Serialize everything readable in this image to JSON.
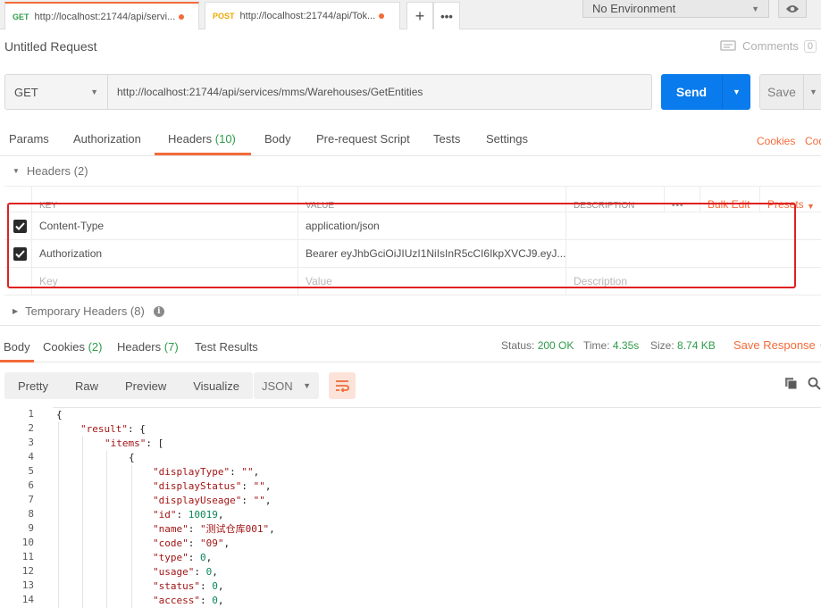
{
  "tabs": [
    {
      "method": "GET",
      "url": "http://localhost:21744/api/servi..."
    },
    {
      "method": "POST",
      "url": "http://localhost:21744/api/Tok..."
    }
  ],
  "environment": "No Environment",
  "request": {
    "title": "Untitled Request",
    "comments_label": "Comments",
    "comments_count": "0",
    "method": "GET",
    "url": "http://localhost:21744/api/services/mms/Warehouses/GetEntities",
    "send_label": "Send",
    "save_label": "Save"
  },
  "request_tabs": {
    "params": "Params",
    "authorization": "Authorization",
    "headers": "Headers",
    "headers_count": "(10)",
    "body": "Body",
    "prerequest": "Pre-request Script",
    "tests": "Tests",
    "settings": "Settings",
    "cookies": "Cookies",
    "code": "Code"
  },
  "headers_section": {
    "title": "Headers (2)",
    "columns": {
      "key": "KEY",
      "value": "VALUE",
      "description": "DESCRIPTION",
      "more": "•••",
      "bulk_edit": "Bulk Edit",
      "presets": "Presets"
    },
    "rows": [
      {
        "key": "Content-Type",
        "value": "application/json"
      },
      {
        "key": "Authorization",
        "value": "Bearer eyJhbGciOiJIUzI1NiIsInR5cCI6IkpXVCJ9.eyJ..."
      }
    ],
    "placeholders": {
      "key": "Key",
      "value": "Value",
      "description": "Description"
    },
    "temporary": "Temporary Headers (8)"
  },
  "response": {
    "tabs": {
      "body": "Body",
      "cookies": "Cookies",
      "cookies_count": "(2)",
      "headers": "Headers",
      "headers_count": "(7)",
      "test_results": "Test Results"
    },
    "status_label": "Status:",
    "status_value": "200 OK",
    "time_label": "Time:",
    "time_value": "4.35s",
    "size_label": "Size:",
    "size_value": "8.74 KB",
    "save_response": "Save Response",
    "views": [
      "Pretty",
      "Raw",
      "Preview",
      "Visualize"
    ],
    "format": "JSON"
  },
  "code_lines": [
    {
      "n": "1",
      "indent": 0,
      "text": "{"
    },
    {
      "n": "2",
      "indent": 1,
      "key": "\"result\"",
      "rest": ": {"
    },
    {
      "n": "3",
      "indent": 2,
      "key": "\"items\"",
      "rest": ": ["
    },
    {
      "n": "4",
      "indent": 3,
      "text": "{"
    },
    {
      "n": "5",
      "indent": 4,
      "key": "\"displayType\"",
      "rest": ": ",
      "str": "\"\"",
      "tail": ","
    },
    {
      "n": "6",
      "indent": 4,
      "key": "\"displayStatus\"",
      "rest": ": ",
      "str": "\"\"",
      "tail": ","
    },
    {
      "n": "7",
      "indent": 4,
      "key": "\"displayUseage\"",
      "rest": ": ",
      "str": "\"\"",
      "tail": ","
    },
    {
      "n": "8",
      "indent": 4,
      "key": "\"id\"",
      "rest": ": ",
      "num": "10019",
      "tail": ","
    },
    {
      "n": "9",
      "indent": 4,
      "key": "\"name\"",
      "rest": ": ",
      "str": "\"测试仓库001\"",
      "tail": ","
    },
    {
      "n": "10",
      "indent": 4,
      "key": "\"code\"",
      "rest": ": ",
      "str": "\"09\"",
      "tail": ","
    },
    {
      "n": "11",
      "indent": 4,
      "key": "\"type\"",
      "rest": ": ",
      "num": "0",
      "tail": ","
    },
    {
      "n": "12",
      "indent": 4,
      "key": "\"usage\"",
      "rest": ": ",
      "num": "0",
      "tail": ","
    },
    {
      "n": "13",
      "indent": 4,
      "key": "\"status\"",
      "rest": ": ",
      "num": "0",
      "tail": ","
    },
    {
      "n": "14",
      "indent": 4,
      "key": "\"access\"",
      "rest": ": ",
      "num": "0",
      "tail": ","
    }
  ],
  "colors": {
    "accent": "#f26b3a",
    "send": "#097bed",
    "ok": "#2e9c4a",
    "highlight_box": "#e02020"
  }
}
